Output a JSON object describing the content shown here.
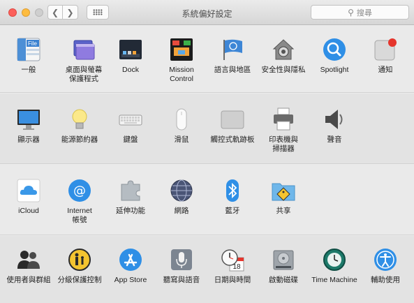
{
  "window": {
    "title": "系統偏好設定"
  },
  "search": {
    "placeholder": "搜尋"
  },
  "rows": [
    [
      {
        "name": "general",
        "label": "一般"
      },
      {
        "name": "desktop-screensaver",
        "label": "桌面與螢幕\n保護程式"
      },
      {
        "name": "dock",
        "label": "Dock"
      },
      {
        "name": "mission-control",
        "label": "Mission\nControl"
      },
      {
        "name": "language-region",
        "label": "語言與地區"
      },
      {
        "name": "security-privacy",
        "label": "安全性與隱私"
      },
      {
        "name": "spotlight",
        "label": "Spotlight"
      },
      {
        "name": "notifications",
        "label": "通知"
      }
    ],
    [
      {
        "name": "displays",
        "label": "顯示器"
      },
      {
        "name": "energy-saver",
        "label": "能源節約器"
      },
      {
        "name": "keyboard",
        "label": "鍵盤"
      },
      {
        "name": "mouse",
        "label": "滑鼠"
      },
      {
        "name": "trackpad",
        "label": "觸控式軌跡板"
      },
      {
        "name": "printers-scanners",
        "label": "印表機與\n掃描器"
      },
      {
        "name": "sound",
        "label": "聲音"
      }
    ],
    [
      {
        "name": "icloud",
        "label": "iCloud"
      },
      {
        "name": "internet-accounts",
        "label": "Internet\n帳號"
      },
      {
        "name": "extensions",
        "label": "延伸功能"
      },
      {
        "name": "network",
        "label": "網路"
      },
      {
        "name": "bluetooth",
        "label": "藍牙"
      },
      {
        "name": "sharing",
        "label": "共享"
      }
    ],
    [
      {
        "name": "users-groups",
        "label": "使用者與群組"
      },
      {
        "name": "parental-controls",
        "label": "分級保護控制"
      },
      {
        "name": "app-store",
        "label": "App Store"
      },
      {
        "name": "dictation-speech",
        "label": "聽寫與語音"
      },
      {
        "name": "date-time",
        "label": "日期與時間"
      },
      {
        "name": "startup-disk",
        "label": "啟動磁碟"
      },
      {
        "name": "time-machine",
        "label": "Time Machine"
      },
      {
        "name": "accessibility",
        "label": "輔助使用"
      }
    ]
  ],
  "icons": {
    "general": "File",
    "date": "18"
  }
}
